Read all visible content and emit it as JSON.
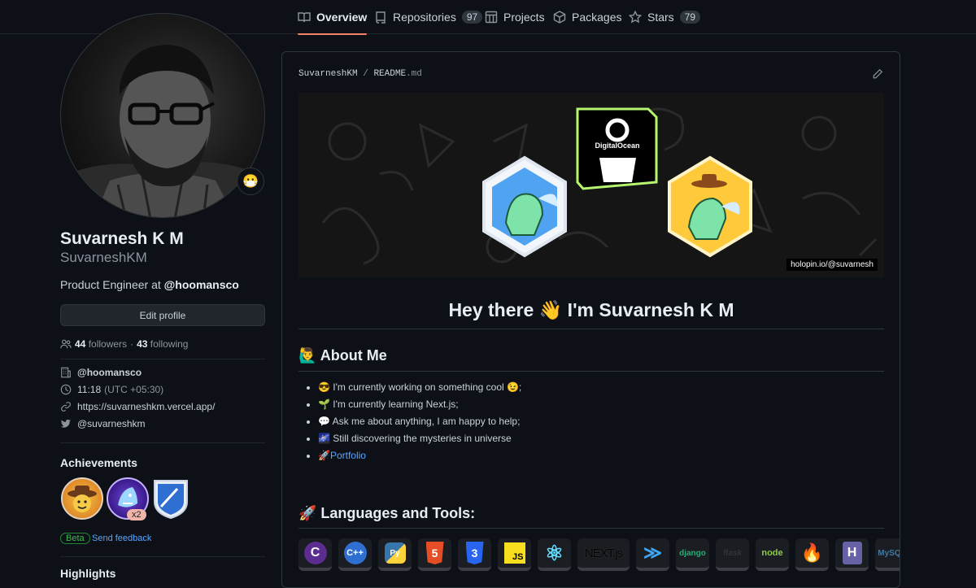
{
  "nav": {
    "tabs": [
      {
        "label": "Overview",
        "count": ""
      },
      {
        "label": "Repositories",
        "count": "97"
      },
      {
        "label": "Projects",
        "count": ""
      },
      {
        "label": "Packages",
        "count": ""
      },
      {
        "label": "Stars",
        "count": "79"
      }
    ]
  },
  "profile": {
    "status_emoji": "😷",
    "name": "Suvarnesh K M",
    "login": "SuvarneshKM",
    "bio_prefix": "Product Engineer at ",
    "bio_org": "@hoomansco",
    "edit_label": "Edit profile",
    "followers_count": "44",
    "followers_label": "followers",
    "following_count": "43",
    "following_label": "following",
    "org": "@hoomansco",
    "time": "11:18",
    "tz": "(UTC +05:30)",
    "website": "https://suvarneshkm.vercel.app/",
    "twitter": "@suvarneshkm"
  },
  "achievements": {
    "title": "Achievements",
    "multiplier": "x2",
    "beta": "Beta",
    "feedback": "Send feedback"
  },
  "highlights": {
    "title": "Highlights"
  },
  "readme": {
    "owner": "SuvarneshKM",
    "sep": "/",
    "file": "README",
    "ext": ".md",
    "banner_tag": "holopin.io/@suvarnesh",
    "banner_badge_text": "DigitalOcean",
    "hero": "Hey there 👋 I'm Suvarnesh K M",
    "about_heading": "🙋‍♂️ About Me",
    "about_items": [
      "😎 I'm currently working on something cool 😉;",
      "🌱 I'm currently learning Next.js;",
      "💬 Ask me about anything, I am happy to help;",
      "🌌 Still discovering the mysteries in universe"
    ],
    "portfolio_prefix": "🚀",
    "portfolio_link": "Portfolio",
    "tools_heading": "🚀 Languages and Tools:",
    "tools": [
      "C",
      "C++",
      "Py",
      "5",
      "3",
      "JS",
      "⚛",
      "NEXT.js",
      "≫",
      "django",
      "flask",
      "node",
      "🔥",
      "H",
      "MySQL"
    ]
  },
  "colors": {
    "accent_underline": "#f78166",
    "link": "#58a6ff",
    "beta_green": "#3fb950"
  }
}
